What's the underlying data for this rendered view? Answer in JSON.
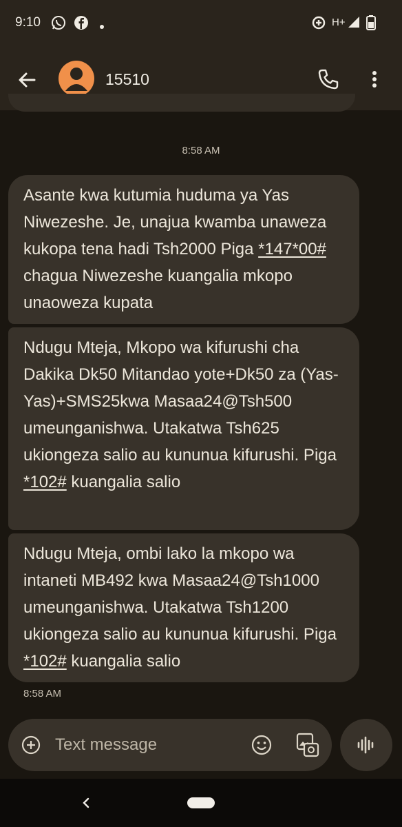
{
  "status_bar": {
    "time": "9:10",
    "network": "H+",
    "icons": [
      "whatsapp-icon",
      "facebook-icon",
      "dot-icon",
      "data-saver-icon",
      "signal-icon",
      "battery-icon"
    ]
  },
  "header": {
    "contact": "15510",
    "avatar_color": "#f0904a"
  },
  "conversation": {
    "timestamp_top": "8:58 AM",
    "messages": [
      {
        "parts": [
          "Asante kwa kutumia huduma ya Yas Niwezeshe. Je, unajua kwamba unaweza kukopa tena hadi Tsh2000 Piga ",
          "*147*00#",
          " chagua Niwezeshe kuangalia mkopo unaoweza kupata"
        ]
      },
      {
        "parts": [
          "Ndugu Mteja, Mkopo wa kifurushi cha Dakika Dk50 Mitandao yote+Dk50 za (Yas-Yas)+SMS25kwa Masaa24@Tsh500 umeunganishwa. Utakatwa Tsh625 ukiongeza salio au kununua kifurushi. Piga ",
          "*102#",
          " kuangalia salio"
        ]
      },
      {
        "parts": [
          "Ndugu Mteja, ombi lako la mkopo wa intaneti MB492 kwa Masaa24@Tsh1000 umeunganishwa. Utakatwa Tsh1200 ukiongeza salio au kununua kifurushi. Piga ",
          "*102#",
          " kuangalia salio"
        ]
      }
    ],
    "timestamp_bottom": "8:58 AM"
  },
  "compose": {
    "placeholder": "Text message"
  }
}
